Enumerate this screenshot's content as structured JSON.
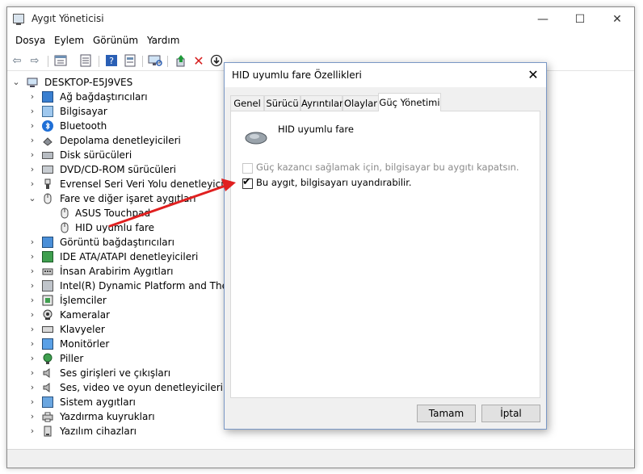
{
  "window": {
    "title": "Aygıt Yöneticisi",
    "minimize": "—",
    "maximize": "☐",
    "close": "✕"
  },
  "menu": {
    "file": "Dosya",
    "action": "Eylem",
    "view": "Görünüm",
    "help": "Yardım"
  },
  "toolbar": {
    "back": "⇦",
    "forward": "⇨"
  },
  "tree": {
    "root": "DESKTOP-E5J9VES",
    "items": [
      {
        "label": "Ağ bağdaştırıcıları"
      },
      {
        "label": "Bilgisayar"
      },
      {
        "label": "Bluetooth"
      },
      {
        "label": "Depolama denetleyicileri"
      },
      {
        "label": "Disk sürücüleri"
      },
      {
        "label": "DVD/CD-ROM sürücüleri"
      },
      {
        "label": "Evrensel Seri Veri Yolu denetleyicileri"
      },
      {
        "label": "Fare ve diğer işaret aygıtları"
      },
      {
        "label": "ASUS Touchpad"
      },
      {
        "label": "HID uyumlu fare"
      },
      {
        "label": "Görüntü bağdaştırıcıları"
      },
      {
        "label": "IDE ATA/ATAPI denetleyicileri"
      },
      {
        "label": "İnsan Arabirim Aygıtları"
      },
      {
        "label": "Intel(R) Dynamic Platform and Therma"
      },
      {
        "label": "İşlemciler"
      },
      {
        "label": "Kameralar"
      },
      {
        "label": "Klavyeler"
      },
      {
        "label": "Monitörler"
      },
      {
        "label": "Piller"
      },
      {
        "label": "Ses girişleri ve çıkışları"
      },
      {
        "label": "Ses, video ve oyun denetleyicileri"
      },
      {
        "label": "Sistem aygıtları"
      },
      {
        "label": "Yazdırma kuyrukları"
      },
      {
        "label": "Yazılım cihazları"
      }
    ]
  },
  "dialog": {
    "title": "HID uyumlu fare Özellikleri",
    "close": "✕",
    "tabs": [
      "Genel",
      "Sürücü",
      "Ayrıntılar",
      "Olaylar",
      "Güç Yönetimi"
    ],
    "device_name": "HID uyumlu fare",
    "option1": {
      "label": "Güç kazancı sağlamak için, bilgisayar bu aygıtı kapatsın.",
      "checked": false,
      "enabled": false
    },
    "option2": {
      "label": "Bu aygıt, bilgisayarı uyandırabilir.",
      "checked": true,
      "enabled": true
    },
    "ok": "Tamam",
    "cancel": "İptal"
  },
  "colors": {
    "accent_arrow": "#e02020",
    "dialog_border": "#7a98c6",
    "delete_red": "#d61f1f"
  }
}
